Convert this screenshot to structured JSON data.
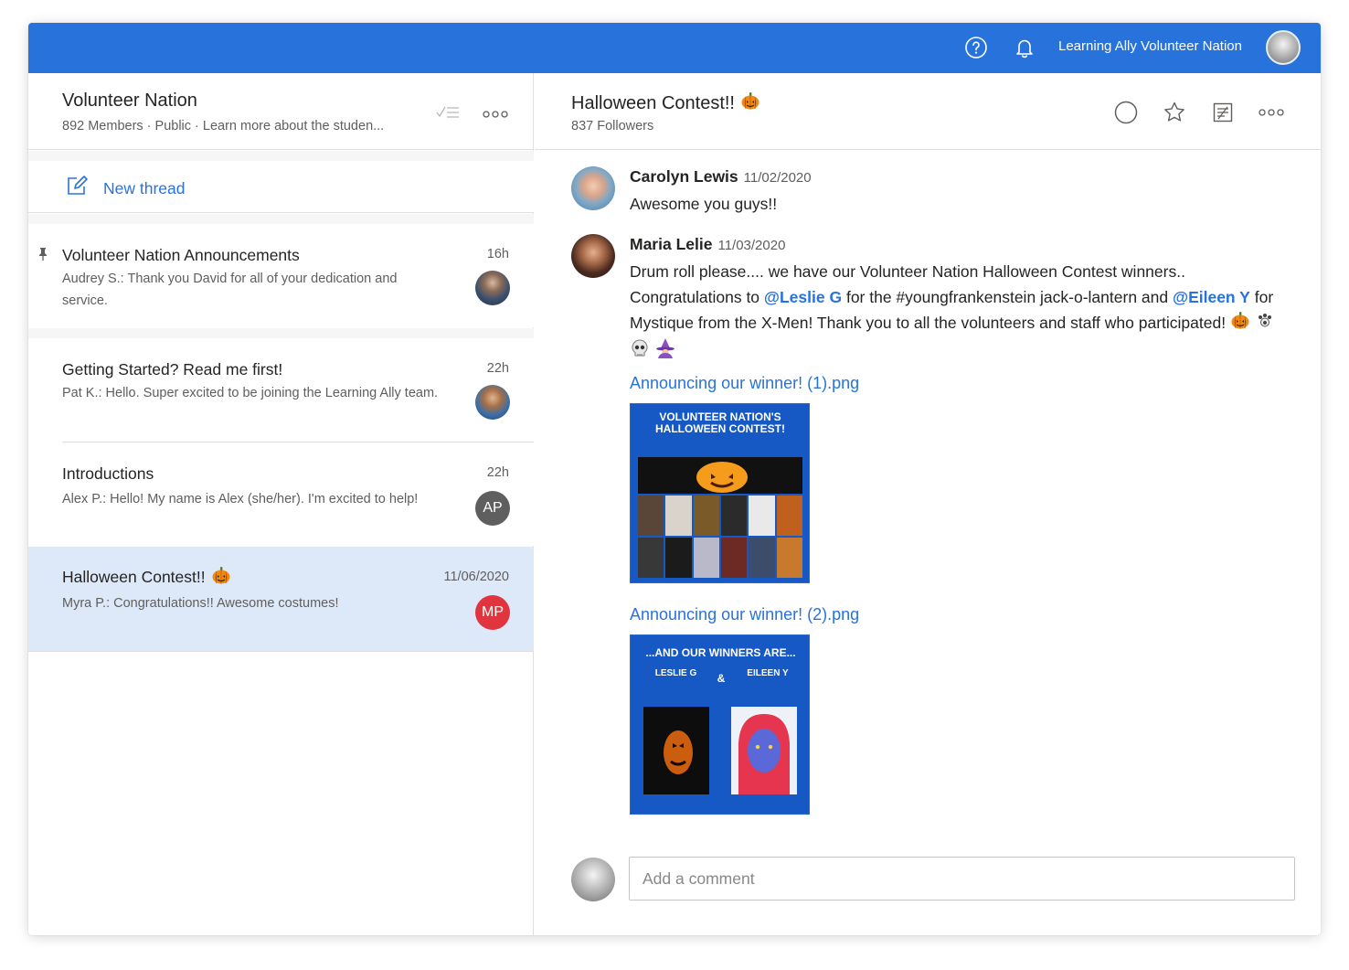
{
  "topbar": {
    "bg": "#2873db",
    "help_icon": "help-circle-icon",
    "bell_icon": "bell-icon",
    "user_network": "Learning Ally Volunteer Nation"
  },
  "group": {
    "name": "Volunteer Nation",
    "meta": "892 Members · Public · Learn more about the studen..."
  },
  "new_thread": {
    "label": "New thread"
  },
  "threads": [
    {
      "title": "Volunteer Nation Announcements",
      "time": "16h",
      "preview": "Audrey S.: Thank you David for all of your dedication and service.",
      "pinned": true,
      "avatar_initials": ""
    },
    {
      "title": "Getting Started? Read me first!",
      "time": "22h",
      "preview": "Pat K.: Hello. Super excited to be joining the Learning Ally team.",
      "pinned": false,
      "avatar_initials": ""
    },
    {
      "title": "Introductions",
      "time": "22h",
      "preview": "Alex P.: Hello! My name is Alex (she/her). I'm excited to help!",
      "pinned": false,
      "avatar_initials": "AP",
      "avatar_color": "#5f5f5f"
    },
    {
      "title": "Halloween Contest!!",
      "time": "11/06/2020",
      "preview": "Myra P.: Congratulations!! Awesome costumes!",
      "pinned": false,
      "selected": true,
      "avatar_initials": "MP",
      "avatar_color": "#e0353f"
    }
  ],
  "topic": {
    "title": "Halloween Contest!!",
    "followers": "837 Followers"
  },
  "messages": [
    {
      "author": "Carolyn Lewis",
      "date": "11/02/2020",
      "text": "Awesome you guys!!"
    },
    {
      "author": "Maria Lelie",
      "date": "11/03/2020",
      "text_1": "Drum roll please.... we have our Volunteer Nation Halloween Contest winners..",
      "text_2": "Congratulations to",
      "mention_1": "@Leslie G",
      "text_3": "for the #youngfrankenstein jack-o-lantern and",
      "mention_2": "@Eileen Y",
      "text_4": "for Mystique from the X-Men! Thank you to all the volunteers and staff who participated!",
      "attachments": [
        {
          "name": "Announcing our winner! (1).png",
          "heading": "VOLUNTEER NATION'S HALLOWEEN CONTEST!"
        },
        {
          "name": "Announcing our winner! (2).png",
          "heading": "...AND OUR WINNERS ARE...",
          "left_name": "LESLIE G",
          "amp": "&",
          "right_name": "EILEEN Y"
        }
      ]
    }
  ],
  "comment": {
    "placeholder": "Add a comment"
  }
}
